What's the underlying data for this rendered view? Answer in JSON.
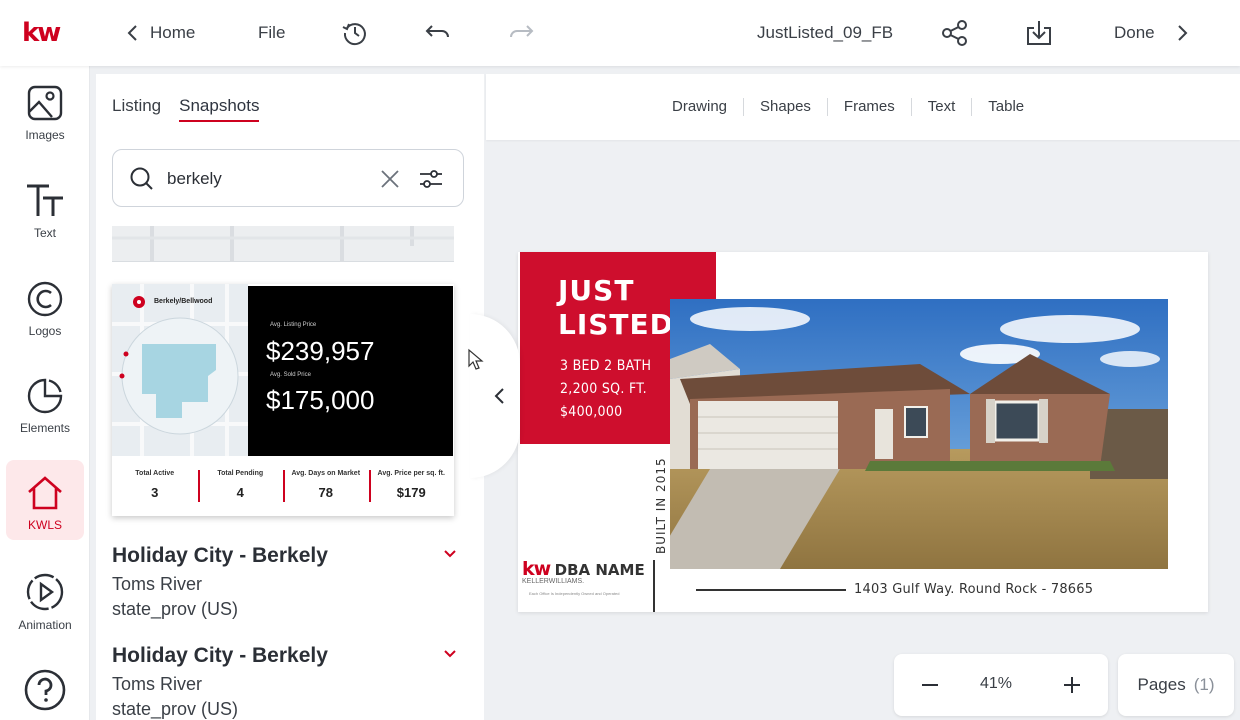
{
  "brand": {
    "logo_text": "kw",
    "accent": "#ce011f"
  },
  "topbar": {
    "home_label": "Home",
    "file_label": "File",
    "document_name": "JustListed_09_FB",
    "done_label": "Done"
  },
  "rail": {
    "items": [
      {
        "label": "Images",
        "icon": "image-icon"
      },
      {
        "label": "Text",
        "icon": "text-icon"
      },
      {
        "label": "Logos",
        "icon": "copyright-icon"
      },
      {
        "label": "Elements",
        "icon": "pie-icon"
      },
      {
        "label": "KWLS",
        "icon": "home-icon",
        "active": true
      },
      {
        "label": "Animation",
        "icon": "play-icon"
      },
      {
        "label": "",
        "icon": "help-icon"
      }
    ]
  },
  "panel": {
    "tabs": [
      {
        "label": "Listing",
        "active": false
      },
      {
        "label": "Snapshots",
        "active": true
      }
    ],
    "search": {
      "value": "berkely"
    },
    "card": {
      "map_label": "Berkely/Bellwood",
      "avg_listing_label": "Avg. Listing Price",
      "avg_listing_value": "$239,957",
      "avg_sold_label": "Avg. Sold Price",
      "avg_sold_value": "$175,000",
      "stats": [
        {
          "label": "Total Active",
          "value": "3"
        },
        {
          "label": "Total Pending",
          "value": "4"
        },
        {
          "label": "Avg. Days on Market",
          "value": "78"
        },
        {
          "label": "Avg. Price per sq. ft.",
          "value": "$179"
        }
      ]
    },
    "results": [
      {
        "title": "Holiday City - Berkely",
        "city": "Toms River",
        "state": "state_prov (US)"
      },
      {
        "title": "Holiday City - Berkely",
        "city": "Toms River",
        "state": "state_prov (US)"
      }
    ]
  },
  "canvas_toolbar": {
    "items": [
      "Drawing",
      "Shapes",
      "Frames",
      "Text",
      "Table"
    ]
  },
  "design": {
    "headline_1": "JUST",
    "headline_2": "LISTED",
    "beds_baths": "3 BED 2 BATH",
    "sqft": "2,200 SQ. FT.",
    "price": "$400,000",
    "built": "BUILT IN 2015",
    "logo_kw": "kw",
    "dba_name": "DBA NAME",
    "kw_sub": "KELLERWILLIAMS.",
    "office_note": "Each Office Is Independently Owned and Operated",
    "address": "1403 Gulf Way. Round Rock - 78665"
  },
  "zoom": {
    "level": "41%"
  },
  "pages": {
    "label": "Pages",
    "count": "(1)"
  }
}
